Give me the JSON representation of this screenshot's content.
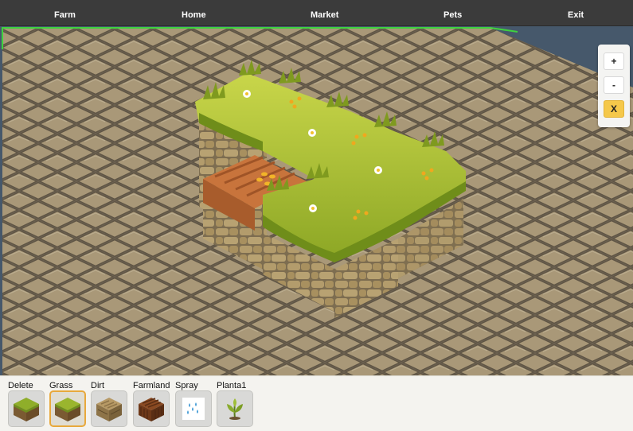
{
  "nav": {
    "items": [
      "Farm",
      "Home",
      "Market",
      "Pets",
      "Exit"
    ]
  },
  "zoom": {
    "zoom_in_label": "+",
    "zoom_out_label": "-",
    "close_label": "X"
  },
  "toolbar": {
    "selected": "Grass",
    "tools": [
      {
        "label": "Delete",
        "icon": "grass-block-icon"
      },
      {
        "label": "Grass",
        "icon": "grass-block-icon"
      },
      {
        "label": "Dirt",
        "icon": "dirt-block-icon"
      },
      {
        "label": "Farmland",
        "icon": "farmland-block-icon"
      },
      {
        "label": "Spray",
        "icon": "water-drops-icon"
      },
      {
        "label": "Planta1",
        "icon": "plant-sprout-icon"
      }
    ]
  },
  "colors": {
    "accent": "#e8a93c",
    "selection_border": "#3fd23f",
    "nav_bg": "#3b3b3b",
    "grass": "#9ab52e",
    "dirt": "#c7743b",
    "stone": "#8b7c63"
  }
}
